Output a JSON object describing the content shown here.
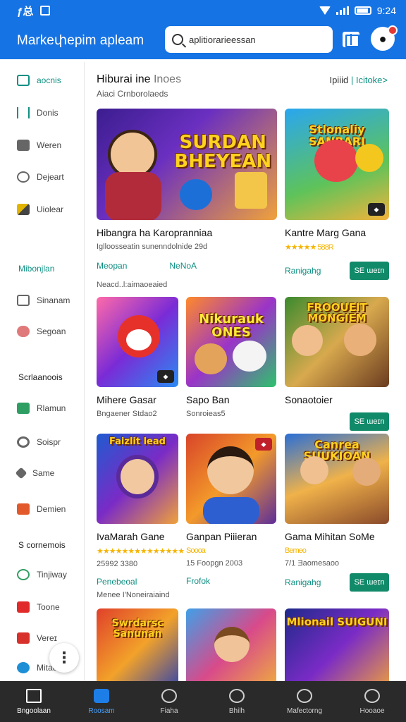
{
  "status": {
    "left_text": "ƒ总",
    "time": "9:24"
  },
  "appbar": {
    "title": "Markeփepim apleam",
    "search_value": "aplitiorarieessan"
  },
  "sidebar": {
    "items": [
      {
        "label": "aocnis",
        "icon": "tv-icon",
        "active": true
      },
      {
        "label": "Donis",
        "icon": "brace-icon"
      },
      {
        "label": "Weren",
        "icon": "camera-icon"
      },
      {
        "label": "Dejeart",
        "icon": "clock-icon"
      },
      {
        "label": "Uiolear",
        "icon": "tag-icon"
      }
    ],
    "head1": "Mibonjlan",
    "items2": [
      {
        "label": "Sinanam",
        "icon": "tablet-icon"
      },
      {
        "label": "Segoan",
        "icon": "cloud-icon"
      }
    ],
    "head2": "Scrlaanoois",
    "items3": [
      {
        "label": "Rlamun",
        "icon": "game-icon"
      },
      {
        "label": "Soispr",
        "icon": "disc-icon"
      },
      {
        "label": "Same",
        "icon": "puzzle-icon"
      },
      {
        "label": "Demien",
        "icon": "box-icon"
      }
    ],
    "head3": "S cornemois",
    "items4": [
      {
        "label": "Tinjiway",
        "icon": "shield-icon"
      },
      {
        "label": "Toone",
        "icon": "flag-icon"
      },
      {
        "label": "Vereɪ",
        "icon": "star-icon"
      },
      {
        "label": "Mitau",
        "icon": "person-icon"
      }
    ]
  },
  "section": {
    "title_main": "Hiburai ine",
    "title_muted": "Inoes",
    "subtitle": "Aiaci Crnborolaeds",
    "link_left": "Ipiiid",
    "link_right": "| Icitoke>"
  },
  "cards": [
    {
      "thumb_text": "SURDAN BHEYEAN",
      "title": "Hibangra ha Karopranniaa",
      "meta": "Iglloosseatin sunenndolnide 29d",
      "price": "Meopan",
      "price2": "NeNoA",
      "note": "Neacd..l:aimaoeaied"
    },
    {
      "thumb_text": "Stlonaliy SANBARI",
      "title": "Kantre Marg Gana",
      "meta": "★★★★★ 588R",
      "price": "Ranigahg",
      "button": "SE ɯeɪn"
    },
    {
      "thumb_text": "",
      "title": "Mihere Gasar",
      "meta": "Bngaener Stdao2"
    },
    {
      "thumb_text": "Nikurauk ONES",
      "title": "Sapo Ban",
      "meta": "Sonroieas5"
    },
    {
      "thumb_text": "FROOUEIT MONGIEM",
      "title": "Sonaotoier",
      "button": "SE ɯeɪn"
    },
    {
      "thumb_text": "Faizlit lead",
      "title": "IvaMarah Gane",
      "meta": "★★★★★★★★★★★★★★",
      "meta2": "25992 3380",
      "price": "Penebeoal"
    },
    {
      "thumb_text": "",
      "title": "Ganpan Piiieran",
      "meta": "Soooa",
      "meta2": "15 Foopgn 2003",
      "price": "Frofok"
    },
    {
      "thumb_text": "Canrea SUUKIOAN",
      "title": "Gama Mihitan SoMe",
      "meta": "Bemeo",
      "meta2": "7/1 Ǝaomesaoo",
      "price": "Ranigahg",
      "button": "SE ɯeɪn"
    }
  ],
  "note2": "Menee I'Noneiraiaind",
  "bottom_row": [
    {
      "thumb_text": "Swrdarsc Sanunan"
    },
    {
      "thumb_text": ""
    },
    {
      "thumb_text": "Mlionail SUIGUNI"
    }
  ],
  "bottomnav": [
    {
      "label": "Bngoolaan",
      "icon": "home-icon"
    },
    {
      "label": "Roosam",
      "icon": "store-icon",
      "active": true
    },
    {
      "label": "Fiaha",
      "icon": "search-icon"
    },
    {
      "label": "Bhilh",
      "icon": "chat-icon"
    },
    {
      "label": "Mafectorng",
      "icon": "gear-icon"
    },
    {
      "label": "Hooaoe",
      "icon": "person-icon"
    }
  ]
}
